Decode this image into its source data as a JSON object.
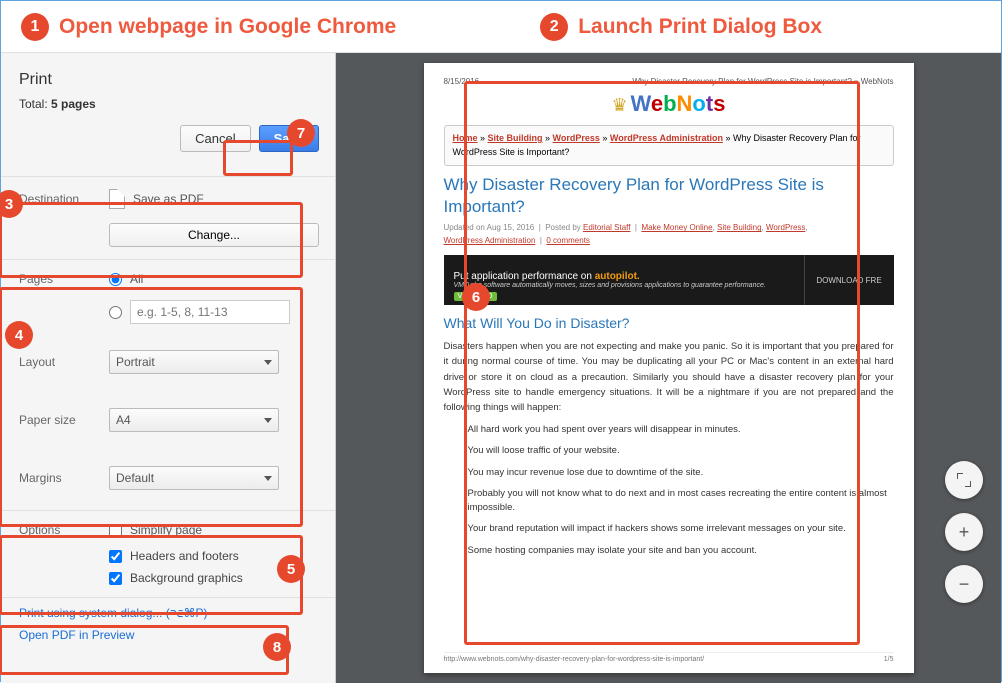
{
  "instructions": {
    "step1": "Open webpage in Google Chrome",
    "step2": "Launch Print Dialog Box"
  },
  "annotations": {
    "b1": "1",
    "b2": "2",
    "b3": "3",
    "b4": "4",
    "b5": "5",
    "b6": "6",
    "b7": "7",
    "b8": "8"
  },
  "print": {
    "title": "Print",
    "total_prefix": "Total: ",
    "total_value": "5 pages",
    "cancel": "Cancel",
    "save": "Save",
    "destination_label": "Destination",
    "destination_value": "Save as PDF",
    "change": "Change...",
    "pages_label": "Pages",
    "pages_all": "All",
    "pages_placeholder": "e.g. 1-5, 8, 11-13",
    "layout_label": "Layout",
    "layout_value": "Portrait",
    "papersize_label": "Paper size",
    "papersize_value": "A4",
    "margins_label": "Margins",
    "margins_value": "Default",
    "options_label": "Options",
    "opt_simplify": "Simplify page",
    "opt_headers": "Headers and footers",
    "opt_background": "Background graphics",
    "link_system": "Print using system dialog... (⌥⌘P)",
    "link_preview": "Open PDF in Preview"
  },
  "preview": {
    "date": "8/15/2016",
    "header_title": "Why Disaster Recovery Plan for WordPress Site is Important? » WebNots",
    "logo": "WebNots",
    "breadcrumb": {
      "home": "Home",
      "sb": "Site Building",
      "wp": "WordPress",
      "wpa": "WordPress Administration",
      "tail": " » Why Disaster Recovery Plan for WordPress Site is Important?"
    },
    "title": "Why Disaster Recovery Plan for WordPress Site is Important?",
    "meta_updated": "Updated on Aug 15, 2016",
    "meta_posted": "Posted by",
    "meta_author": "Editorial Staff",
    "meta_links": {
      "mmo": "Make Money Online",
      "sb": "Site Building",
      "wp": "WordPress",
      "wpa": "WordPress Administration",
      "comments": "0 comments"
    },
    "banner_line": "Put application performance on ",
    "banner_auto": "autopilot.",
    "banner_sub": "VMTurbo software automatically moves, sizes and provisions applications to guarantee performance.",
    "banner_vm": "VMTURBO",
    "banner_dl": "DOWNLOAD FRE",
    "h2": "What Will You Do in Disaster?",
    "para": "Disasters happen when you are not expecting and make you panic. So it is important that you prepared for it during normal course of time. You may be duplicating all your PC or Mac's content in an external hard drive or store it on cloud as a precaution. Similarly you should have a disaster recovery plan for your WordPress site to handle emergency situations. It will be a nightmare if you are not prepared and the following things will happen:",
    "bullets": {
      "b1": "All hard work you had spent over years will disappear in minutes.",
      "b2": "You will loose traffic of your website.",
      "b3": "You may incur revenue lose due to downtime of the site.",
      "b4": "Probably you will not know what to do next and in most cases recreating the entire content is almost impossible.",
      "b5": "Your brand reputation will impact if hackers shows some irrelevant messages on your site.",
      "b6": "Some hosting companies may isolate your site and ban you account."
    },
    "footer_url": "http://www.webnots.com/why-disaster-recovery-plan-for-wordpress-site-is-important/",
    "footer_page": "1/5"
  }
}
